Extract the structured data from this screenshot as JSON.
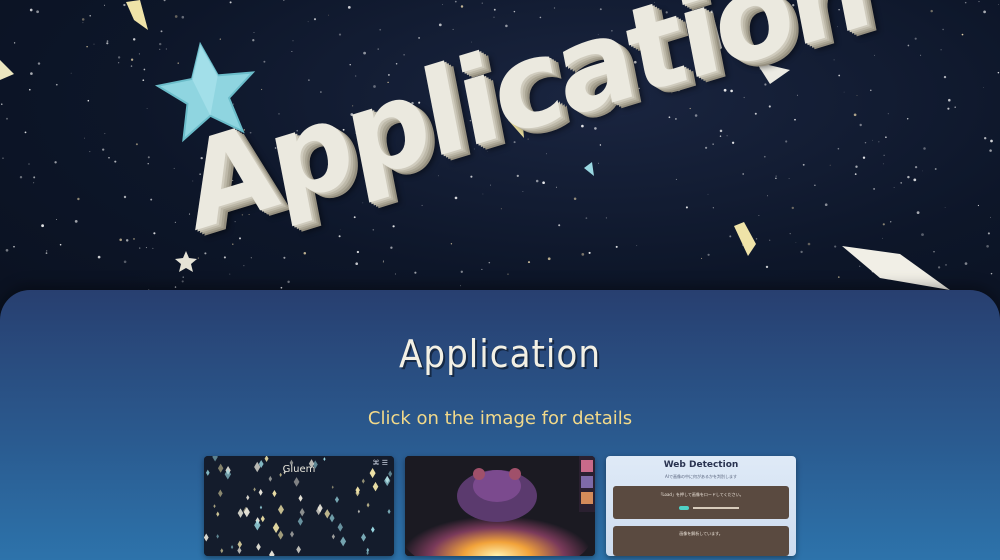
{
  "hero": {
    "heading": "Application"
  },
  "section": {
    "title": "Application",
    "subtitle": "Click on the image for details"
  },
  "cards": [
    {
      "title": "Gluem",
      "corner_label": "⌘ ☰"
    },
    {
      "title": ""
    },
    {
      "title": "Web Detection",
      "subtitle": "AIで画像の中に何があるかを判別します",
      "panel_text": "「Load」を押して画像をロードしてください。",
      "panel2_text": "画像を解析しています。"
    }
  ],
  "colors": {
    "panel_top": "#283f70",
    "panel_bottom": "#2d73ab",
    "subtitle": "#f2d98a",
    "title_text": "#f3f0e4"
  },
  "icons": [
    "star-icon",
    "crystal-icon"
  ]
}
